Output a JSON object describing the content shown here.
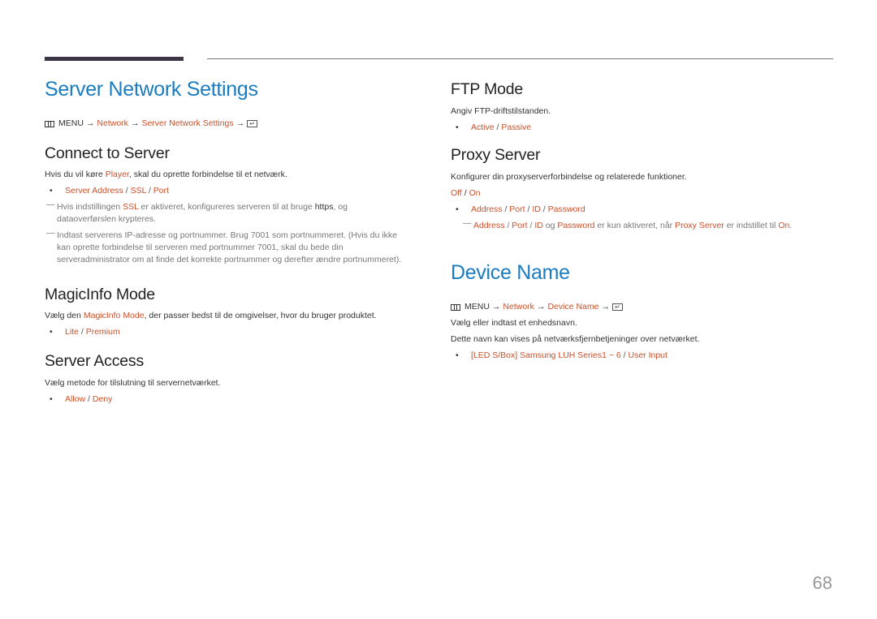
{
  "page_number": "68",
  "left": {
    "title": "Server Network Settings",
    "menu_path": {
      "menu_label": "MENU",
      "steps": [
        "Network",
        "Server Network Settings"
      ],
      "arrow": "→"
    },
    "connect_to_server": {
      "heading": "Connect to Server",
      "desc_pre": "Hvis du vil køre ",
      "desc_hl": "Player",
      "desc_post": ", skal du oprette forbindelse til et netværk.",
      "options": [
        "Server Address",
        "SSL",
        "Port"
      ],
      "note1_pre": "Hvis indstillingen ",
      "note1_hl": "SSL",
      "note1_mid": " er aktiveret, konfigureres serveren til at bruge ",
      "note1_bold": "https",
      "note1_post": ", og dataoverførslen krypteres.",
      "note2": "Indtast serverens IP-adresse og portnummer. Brug 7001 som portnummeret. (Hvis du ikke kan oprette forbindelse til serveren med portnummer 7001, skal du bede din serveradministrator om at finde det korrekte portnummer og derefter ændre portnummeret)."
    },
    "magicinfo_mode": {
      "heading": "MagicInfo Mode",
      "desc_pre": "Vælg den ",
      "desc_hl": "MagicInfo Mode",
      "desc_post": ", der passer bedst til de omgivelser, hvor du bruger produktet.",
      "options": [
        "Lite",
        "Premium"
      ]
    },
    "server_access": {
      "heading": "Server Access",
      "desc": "Vælg metode for tilslutning til servernetværket.",
      "options": [
        "Allow",
        "Deny"
      ]
    }
  },
  "right": {
    "ftp_mode": {
      "heading": "FTP Mode",
      "desc": "Angiv FTP-driftstilstanden.",
      "options": [
        "Active",
        "Passive"
      ]
    },
    "proxy_server": {
      "heading": "Proxy Server",
      "desc": "Konfigurer din proxyserverforbindelse og relaterede funktioner.",
      "toggle": [
        "Off",
        "On"
      ],
      "options": [
        "Address",
        "Port",
        "ID",
        "Password"
      ],
      "note": {
        "a": "Address",
        "b": "Port",
        "c": "ID",
        "og": " og ",
        "d": "Password",
        "mid": " er kun aktiveret, når ",
        "e": "Proxy Server",
        "mid2": " er indstillet til ",
        "f": "On",
        "end": "."
      }
    },
    "device_name": {
      "title": "Device Name",
      "menu_path": {
        "menu_label": "MENU",
        "steps": [
          "Network",
          "Device Name"
        ],
        "arrow": "→"
      },
      "desc1": "Vælg eller indtast et enhedsnavn.",
      "desc2": "Dette navn kan vises på netværksfjernbetjeninger over netværket.",
      "options": [
        "[LED S/Box] Samsung LUH Series1 ~ 6",
        "User Input"
      ]
    }
  },
  "separator": " / ",
  "colors": {
    "title": "#1a7cc0",
    "highlight": "#c9502a",
    "bar": "#3b3546"
  }
}
